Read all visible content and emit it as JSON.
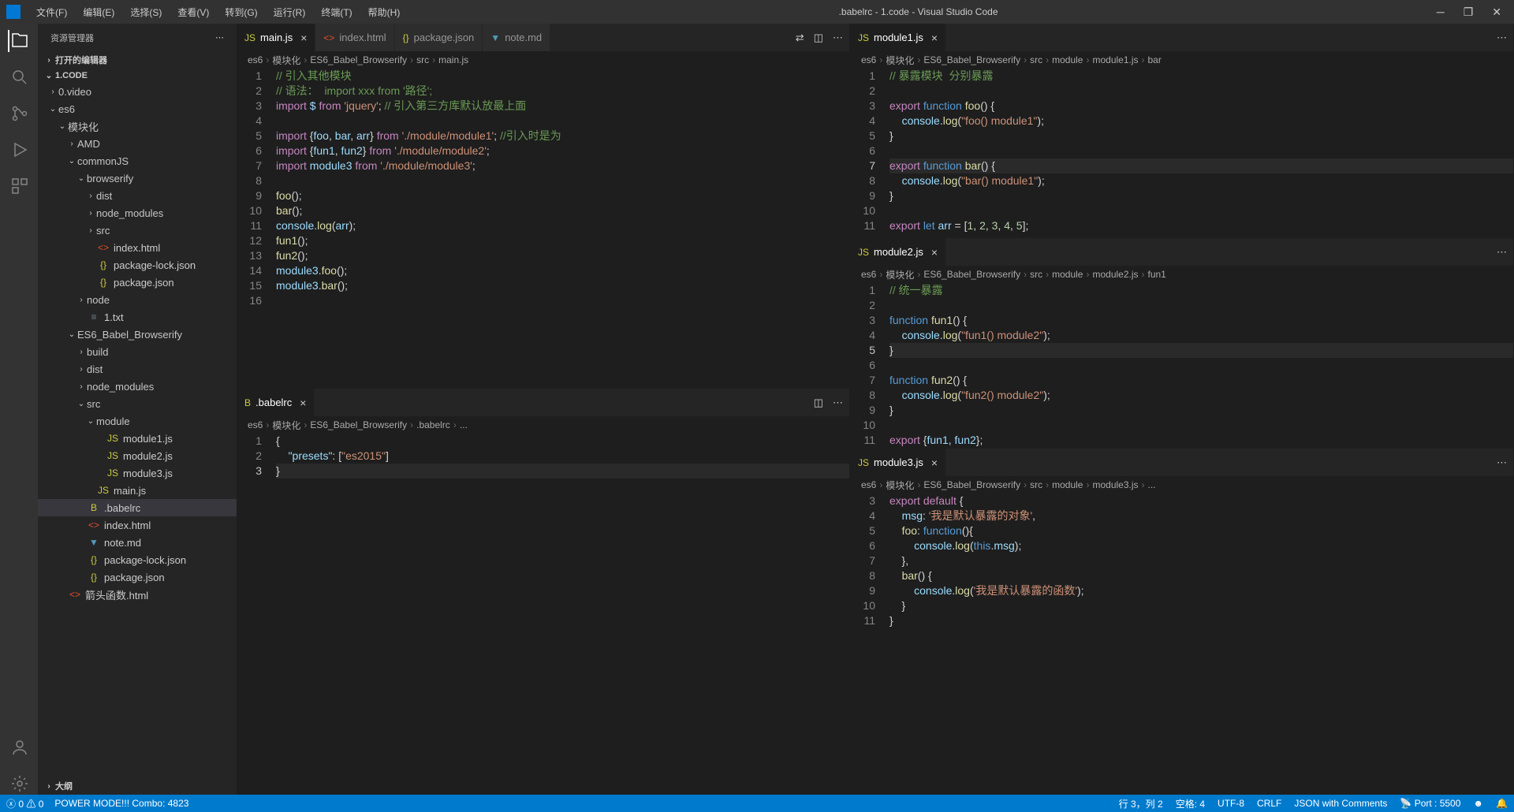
{
  "title": ".babelrc - 1.code - Visual Studio Code",
  "menu": [
    "文件(F)",
    "编辑(E)",
    "选择(S)",
    "查看(V)",
    "转到(G)",
    "运行(R)",
    "终端(T)",
    "帮助(H)"
  ],
  "sidebar": {
    "title": "资源管理器",
    "sections": {
      "open_editors": "打开的编辑器",
      "workspace": "1.CODE",
      "outline": "大纲"
    },
    "tree": [
      {
        "d": 1,
        "t": "folder",
        "c": "›",
        "n": "0.video"
      },
      {
        "d": 1,
        "t": "folder",
        "c": "⌄",
        "n": "es6"
      },
      {
        "d": 2,
        "t": "folder",
        "c": "⌄",
        "n": "模块化"
      },
      {
        "d": 3,
        "t": "folder",
        "c": "›",
        "n": "AMD"
      },
      {
        "d": 3,
        "t": "folder",
        "c": "⌄",
        "n": "commonJS"
      },
      {
        "d": 4,
        "t": "folder",
        "c": "⌄",
        "n": "browserify"
      },
      {
        "d": 5,
        "t": "folder",
        "c": "›",
        "n": "dist"
      },
      {
        "d": 5,
        "t": "folder",
        "c": "›",
        "n": "node_modules"
      },
      {
        "d": 5,
        "t": "folder",
        "c": "›",
        "n": "src"
      },
      {
        "d": 5,
        "t": "file",
        "i": "html",
        "n": "index.html"
      },
      {
        "d": 5,
        "t": "file",
        "i": "json",
        "n": "package-lock.json"
      },
      {
        "d": 5,
        "t": "file",
        "i": "json",
        "n": "package.json"
      },
      {
        "d": 4,
        "t": "folder",
        "c": "›",
        "n": "node"
      },
      {
        "d": 4,
        "t": "file",
        "i": "txt",
        "n": "1.txt"
      },
      {
        "d": 3,
        "t": "folder",
        "c": "⌄",
        "n": "ES6_Babel_Browserify"
      },
      {
        "d": 4,
        "t": "folder",
        "c": "›",
        "n": "build"
      },
      {
        "d": 4,
        "t": "folder",
        "c": "›",
        "n": "dist"
      },
      {
        "d": 4,
        "t": "folder",
        "c": "›",
        "n": "node_modules"
      },
      {
        "d": 4,
        "t": "folder",
        "c": "⌄",
        "n": "src"
      },
      {
        "d": 5,
        "t": "folder",
        "c": "⌄",
        "n": "module"
      },
      {
        "d": 6,
        "t": "file",
        "i": "js",
        "n": "module1.js"
      },
      {
        "d": 6,
        "t": "file",
        "i": "js",
        "n": "module2.js"
      },
      {
        "d": 6,
        "t": "file",
        "i": "js",
        "n": "module3.js"
      },
      {
        "d": 5,
        "t": "file",
        "i": "js",
        "n": "main.js"
      },
      {
        "d": 4,
        "t": "file",
        "i": "babel",
        "n": ".babelrc",
        "sel": true
      },
      {
        "d": 4,
        "t": "file",
        "i": "html",
        "n": "index.html"
      },
      {
        "d": 4,
        "t": "file",
        "i": "md",
        "n": "note.md"
      },
      {
        "d": 4,
        "t": "file",
        "i": "json",
        "n": "package-lock.json"
      },
      {
        "d": 4,
        "t": "file",
        "i": "json",
        "n": "package.json"
      },
      {
        "d": 2,
        "t": "file",
        "i": "html",
        "n": "箭头函数.html"
      }
    ]
  },
  "tl_tabs": [
    {
      "i": "js",
      "n": "main.js",
      "active": true
    },
    {
      "i": "html",
      "n": "index.html"
    },
    {
      "i": "json",
      "n": "package.json"
    },
    {
      "i": "md",
      "n": "note.md"
    }
  ],
  "tl_bc": [
    "es6",
    "模块化",
    "ES6_Babel_Browserify",
    "src",
    "main.js"
  ],
  "bl_tab": {
    "i": "babel",
    "n": ".babelrc"
  },
  "bl_bc": [
    "es6",
    "模块化",
    "ES6_Babel_Browserify",
    ".babelrc",
    "..."
  ],
  "r1_tab": {
    "i": "js",
    "n": "module1.js"
  },
  "r1_bc": [
    "es6",
    "模块化",
    "ES6_Babel_Browserify",
    "src",
    "module",
    "module1.js",
    "bar"
  ],
  "r2_tab": {
    "i": "js",
    "n": "module2.js"
  },
  "r2_bc": [
    "es6",
    "模块化",
    "ES6_Babel_Browserify",
    "src",
    "module",
    "module2.js",
    "fun1"
  ],
  "r3_tab": {
    "i": "js",
    "n": "module3.js"
  },
  "r3_bc": [
    "es6",
    "模块化",
    "ES6_Babel_Browserify",
    "src",
    "module",
    "module3.js",
    "..."
  ],
  "status": {
    "errors": "0",
    "warnings": "0",
    "power": "POWER MODE!!! Combo: 4823",
    "ln": "行 3，列 2",
    "spaces": "空格: 4",
    "enc": "UTF-8",
    "eol": "CRLF",
    "lang": "JSON with Comments",
    "port": "Port : 5500"
  },
  "code": {
    "main": [
      {
        "n": 1,
        "h": "<span class='c-cmt'>// 引入其他模块</span>"
      },
      {
        "n": 2,
        "h": "<span class='c-cmt'>// 语法：  import xxx from '路径';</span>"
      },
      {
        "n": 3,
        "h": "<span class='c-kw'>import</span> <span class='c-var'>$</span> <span class='c-kw'>from</span> <span class='c-str'>'jquery'</span>; <span class='c-cmt'>// 引入第三方库默认放最上面</span>"
      },
      {
        "n": 4,
        "h": ""
      },
      {
        "n": 5,
        "h": "<span class='c-kw'>import</span> {<span class='c-var'>foo</span>, <span class='c-var'>bar</span>, <span class='c-var'>arr</span>} <span class='c-kw'>from</span> <span class='c-str'>'./module/module1'</span>; <span class='c-cmt'>//引入时是为</span>"
      },
      {
        "n": 6,
        "h": "<span class='c-kw'>import</span> {<span class='c-var'>fun1</span>, <span class='c-var'>fun2</span>} <span class='c-kw'>from</span> <span class='c-str'>'./module/module2'</span>;"
      },
      {
        "n": 7,
        "h": "<span class='c-kw'>import</span> <span class='c-var'>module3</span> <span class='c-kw'>from</span> <span class='c-str'>'./module/module3'</span>;"
      },
      {
        "n": 8,
        "h": ""
      },
      {
        "n": 9,
        "h": "<span class='c-fn'>foo</span>();"
      },
      {
        "n": 10,
        "h": "<span class='c-fn'>bar</span>();"
      },
      {
        "n": 11,
        "h": "<span class='c-var'>console</span>.<span class='c-fn'>log</span>(<span class='c-var'>arr</span>);"
      },
      {
        "n": 12,
        "h": "<span class='c-fn'>fun1</span>();"
      },
      {
        "n": 13,
        "h": "<span class='c-fn'>fun2</span>();"
      },
      {
        "n": 14,
        "h": "<span class='c-var'>module3</span>.<span class='c-fn'>foo</span>();"
      },
      {
        "n": 15,
        "h": "<span class='c-var'>module3</span>.<span class='c-fn'>bar</span>();"
      },
      {
        "n": 16,
        "h": ""
      }
    ],
    "babel": [
      {
        "n": 1,
        "h": "<span class='c-pun'>{</span>"
      },
      {
        "n": 2,
        "h": "    <span class='c-var'>\"presets\"</span>: [<span class='c-str'>\"es2015\"</span>]"
      },
      {
        "n": 3,
        "h": "<span class='c-pun'>}</span>",
        "hl": true
      }
    ],
    "m1": [
      {
        "n": 1,
        "h": "<span class='c-cmt'>// 暴露模块  分别暴露</span>"
      },
      {
        "n": 2,
        "h": ""
      },
      {
        "n": 3,
        "h": "<span class='c-kw'>export</span> <span class='c-blue'>function</span> <span class='c-fn'>foo</span>() {"
      },
      {
        "n": 4,
        "h": "    <span class='c-var'>console</span>.<span class='c-fn'>log</span>(<span class='c-str'>\"foo() module1\"</span>);"
      },
      {
        "n": 5,
        "h": "}"
      },
      {
        "n": 6,
        "h": ""
      },
      {
        "n": 7,
        "h": "<span class='c-kw'>export</span> <span class='c-blue'>function</span> <span class='c-fn'>bar</span>() {",
        "hl": true
      },
      {
        "n": 8,
        "h": "    <span class='c-var'>console</span>.<span class='c-fn'>log</span>(<span class='c-str'>\"bar() module1\"</span>);"
      },
      {
        "n": 9,
        "h": "}"
      },
      {
        "n": 10,
        "h": ""
      },
      {
        "n": 11,
        "h": "<span class='c-kw'>export</span> <span class='c-blue'>let</span> <span class='c-var'>arr</span> = [<span class='c-num'>1</span>, <span class='c-num'>2</span>, <span class='c-num'>3</span>, <span class='c-num'>4</span>, <span class='c-num'>5</span>];"
      }
    ],
    "m2": [
      {
        "n": 1,
        "h": "<span class='c-cmt'>// 统一暴露</span>"
      },
      {
        "n": 2,
        "h": ""
      },
      {
        "n": 3,
        "h": "<span class='c-blue'>function</span> <span class='c-fn'>fun1</span>() {"
      },
      {
        "n": 4,
        "h": "    <span class='c-var'>console</span>.<span class='c-fn'>log</span>(<span class='c-str'>\"fun1() module2\"</span>);"
      },
      {
        "n": 5,
        "h": "}",
        "hl": true
      },
      {
        "n": 6,
        "h": ""
      },
      {
        "n": 7,
        "h": "<span class='c-blue'>function</span> <span class='c-fn'>fun2</span>() {"
      },
      {
        "n": 8,
        "h": "    <span class='c-var'>console</span>.<span class='c-fn'>log</span>(<span class='c-str'>\"fun2() module2\"</span>);"
      },
      {
        "n": 9,
        "h": "}"
      },
      {
        "n": 10,
        "h": ""
      },
      {
        "n": 11,
        "h": "<span class='c-kw'>export</span> {<span class='c-var'>fun1</span>, <span class='c-var'>fun2</span>};"
      }
    ],
    "m3": [
      {
        "n": 3,
        "h": "<span class='c-kw'>export</span> <span class='c-kw'>default</span> {"
      },
      {
        "n": 4,
        "h": "    <span class='c-var'>msg</span>: <span class='c-str'>'我是默认暴露的对象'</span>,"
      },
      {
        "n": 5,
        "h": "    <span class='c-fn'>foo</span>: <span class='c-blue'>function</span>(){"
      },
      {
        "n": 6,
        "h": "        <span class='c-var'>console</span>.<span class='c-fn'>log</span>(<span class='c-blue'>this</span>.<span class='c-var'>msg</span>);"
      },
      {
        "n": 7,
        "h": "    },"
      },
      {
        "n": 8,
        "h": "    <span class='c-fn'>bar</span>() {"
      },
      {
        "n": 9,
        "h": "        <span class='c-var'>console</span>.<span class='c-fn'>log</span>(<span class='c-str'>'我是默认暴露的函数'</span>);"
      },
      {
        "n": 10,
        "h": "    }"
      },
      {
        "n": 11,
        "h": "}"
      }
    ]
  }
}
